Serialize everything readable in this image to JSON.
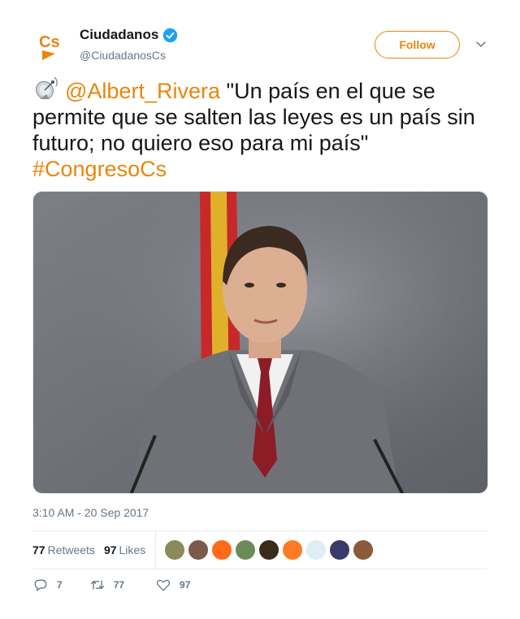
{
  "account": {
    "display_name": "Ciudadanos",
    "handle": "@CiudadanosCs",
    "logo_text": "Cs",
    "verified": true
  },
  "follow_label": "Follow",
  "tweet": {
    "icon": "satellite-antenna-emoji",
    "mention": "@Albert_Rivera",
    "text": " \"Un país en el que se permite que se salten las leyes es un país sin futuro; no quiero eso para mi país\" ",
    "hashtag": "#CongresoCs"
  },
  "timestamp": "3:10 AM - 20 Sep 2017",
  "stats": {
    "retweets_count": "77",
    "retweets_label": "Retweets",
    "likes_count": "97",
    "likes_label": "Likes"
  },
  "liker_avatars": [
    {
      "name": "liker-avatar-1",
      "color": "#8a8a5a"
    },
    {
      "name": "liker-avatar-2",
      "color": "#7a5a4a"
    },
    {
      "name": "liker-avatar-3",
      "color": "#ff6a1a"
    },
    {
      "name": "liker-avatar-4",
      "color": "#6a8a5a"
    },
    {
      "name": "liker-avatar-5",
      "color": "#3a2a1a"
    },
    {
      "name": "liker-avatar-6",
      "color": "#ff7a22"
    },
    {
      "name": "liker-avatar-7",
      "color": "#dfeef5"
    },
    {
      "name": "liker-avatar-8",
      "color": "#3a3a6a"
    },
    {
      "name": "liker-avatar-9",
      "color": "#8a5a3a"
    }
  ],
  "actions": {
    "replies": "7",
    "retweets": "77",
    "likes": "97"
  },
  "colors": {
    "brand": "#E8860C",
    "verified": "#1DA1F2",
    "muted": "#657786",
    "text": "#14171a"
  }
}
